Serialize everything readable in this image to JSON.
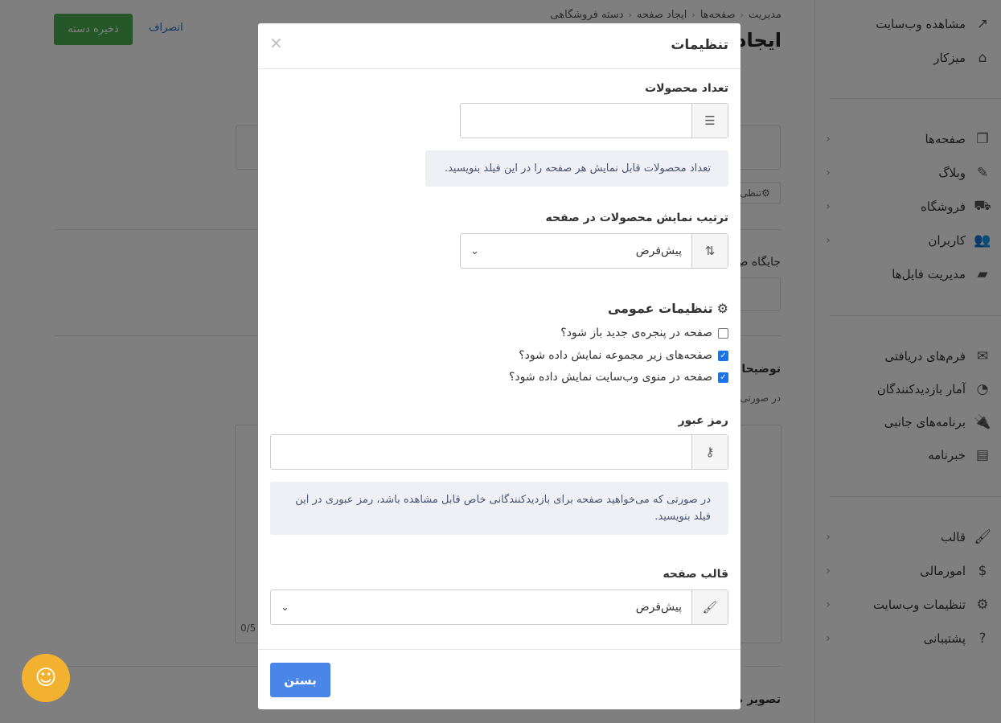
{
  "header": {
    "breadcrumb": [
      "مدیریت",
      "صفحه‌ها",
      "ایجاد صفحه",
      "دسته فروشگاهی"
    ],
    "page_title": "ایجاد",
    "save_label": "ذخیره دسته",
    "cancel_label": "انصراف"
  },
  "sidebar": {
    "top_items": [
      {
        "label": "مشاهده وب‌سایت",
        "icon": "external-link-icon"
      },
      {
        "label": "میزکار",
        "icon": "home-icon"
      }
    ],
    "group1": [
      {
        "label": "صفحه‌ها",
        "icon": "copy-icon"
      },
      {
        "label": "وبلاگ",
        "icon": "pencil-icon"
      },
      {
        "label": "فروشگاه",
        "icon": "cart-icon"
      },
      {
        "label": "کاربران",
        "icon": "users-icon"
      },
      {
        "label": "مدیریت فایل‌ها",
        "icon": "folder-icon"
      }
    ],
    "group2": [
      {
        "label": "فرم‌های دریافتی",
        "icon": "envelope-icon"
      },
      {
        "label": "آمار بازدیدکنندگان",
        "icon": "chart-icon"
      },
      {
        "label": "برنامه‌های جانبی",
        "icon": "plug-icon"
      },
      {
        "label": "خبرنامه",
        "icon": "newspaper-icon"
      }
    ],
    "group3": [
      {
        "label": "قالب",
        "icon": "brush-icon"
      },
      {
        "label": "امورمالی",
        "icon": "dollar-icon"
      },
      {
        "label": "تنظیمات وب‌سایت",
        "icon": "gear-icon"
      },
      {
        "label": "پشتیبانی",
        "icon": "question-icon"
      }
    ]
  },
  "background": {
    "settings_chip": "تنظی",
    "position_label": "جایگاه ص",
    "description_label": "توضیحا",
    "description_hint": "در صورتی",
    "char_counter": "0/5",
    "image_label": "تصویر ص"
  },
  "modal": {
    "title": "تنظیمات",
    "close_symbol": "×",
    "product_count": {
      "label": "تعداد محصولات",
      "value": "",
      "help": "تعداد محصولات قابل نمایش هر صفحه را در این فیلد بنویسید."
    },
    "sort_order": {
      "label": "ترتیب نمایش محصولات در صفحه",
      "selected": "پیش‌فرض"
    },
    "general": {
      "title": "تنظیمات عمومی",
      "options": [
        {
          "label": "صفحه در پنجره‌ی جدید باز شود؟",
          "checked": false
        },
        {
          "label": "صفحه‌های زیر مجموعه نمایش داده شود؟",
          "checked": true
        },
        {
          "label": "صفحه در منوی وب‌سایت نمایش داده شود؟",
          "checked": true
        }
      ]
    },
    "password": {
      "label": "رمز عبور",
      "value": "",
      "help": "در صورتی که می‌خواهید صفحه برای بازدیدکنندگانی خاص قابل مشاهده باشد، رمز عبوری در این فیلد بنویسید."
    },
    "template": {
      "label": "قالب صفحه",
      "selected": "پیش‌فرض"
    },
    "close_button": "بستن"
  },
  "colors": {
    "save_green": "#4caf50",
    "primary_blue": "#4a86e8",
    "support_orange": "#f2b230"
  }
}
